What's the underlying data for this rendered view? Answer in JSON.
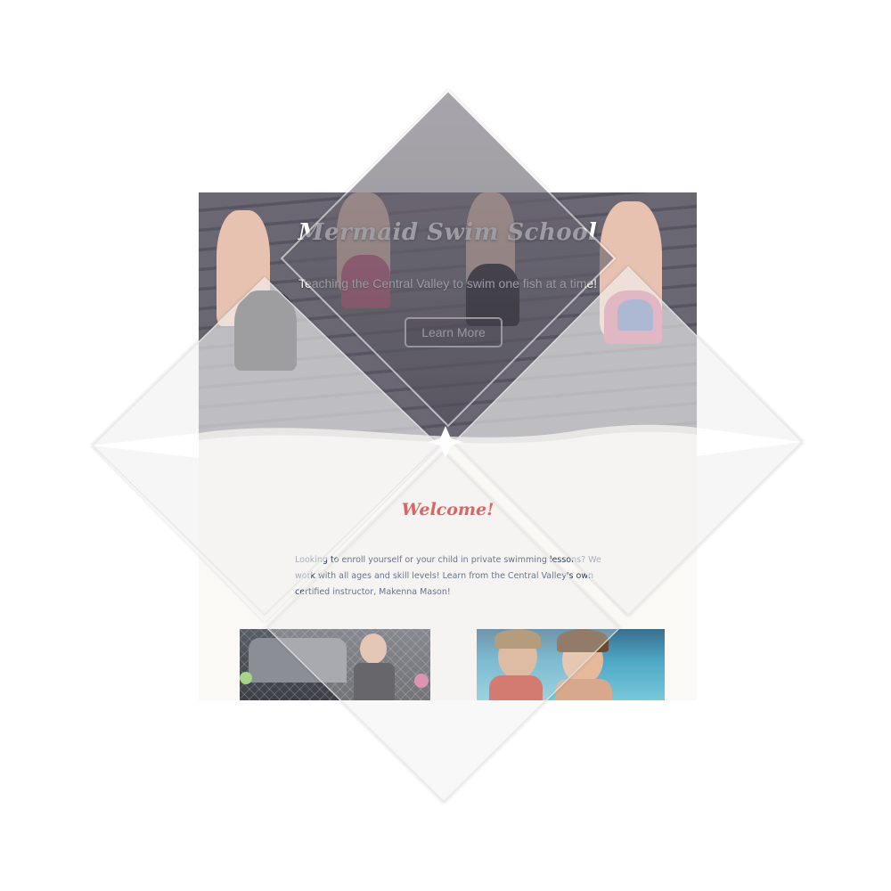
{
  "hero": {
    "title": "Mermaid Swim School",
    "subtitle": "Teaching the Central Valley to swim one fish at a time!",
    "cta_label": "Learn More"
  },
  "welcome": {
    "heading": "Welcome!",
    "body": "Looking to enroll yourself or your child in private swimming lessons? We work with all ages and skill levels! Learn from the Central Valley's own certified instructor, Makenna Mason!"
  },
  "colors": {
    "accent_red": "#d42a2a",
    "body_text": "#2e3c5a",
    "page_background": "#fbf9f5"
  }
}
